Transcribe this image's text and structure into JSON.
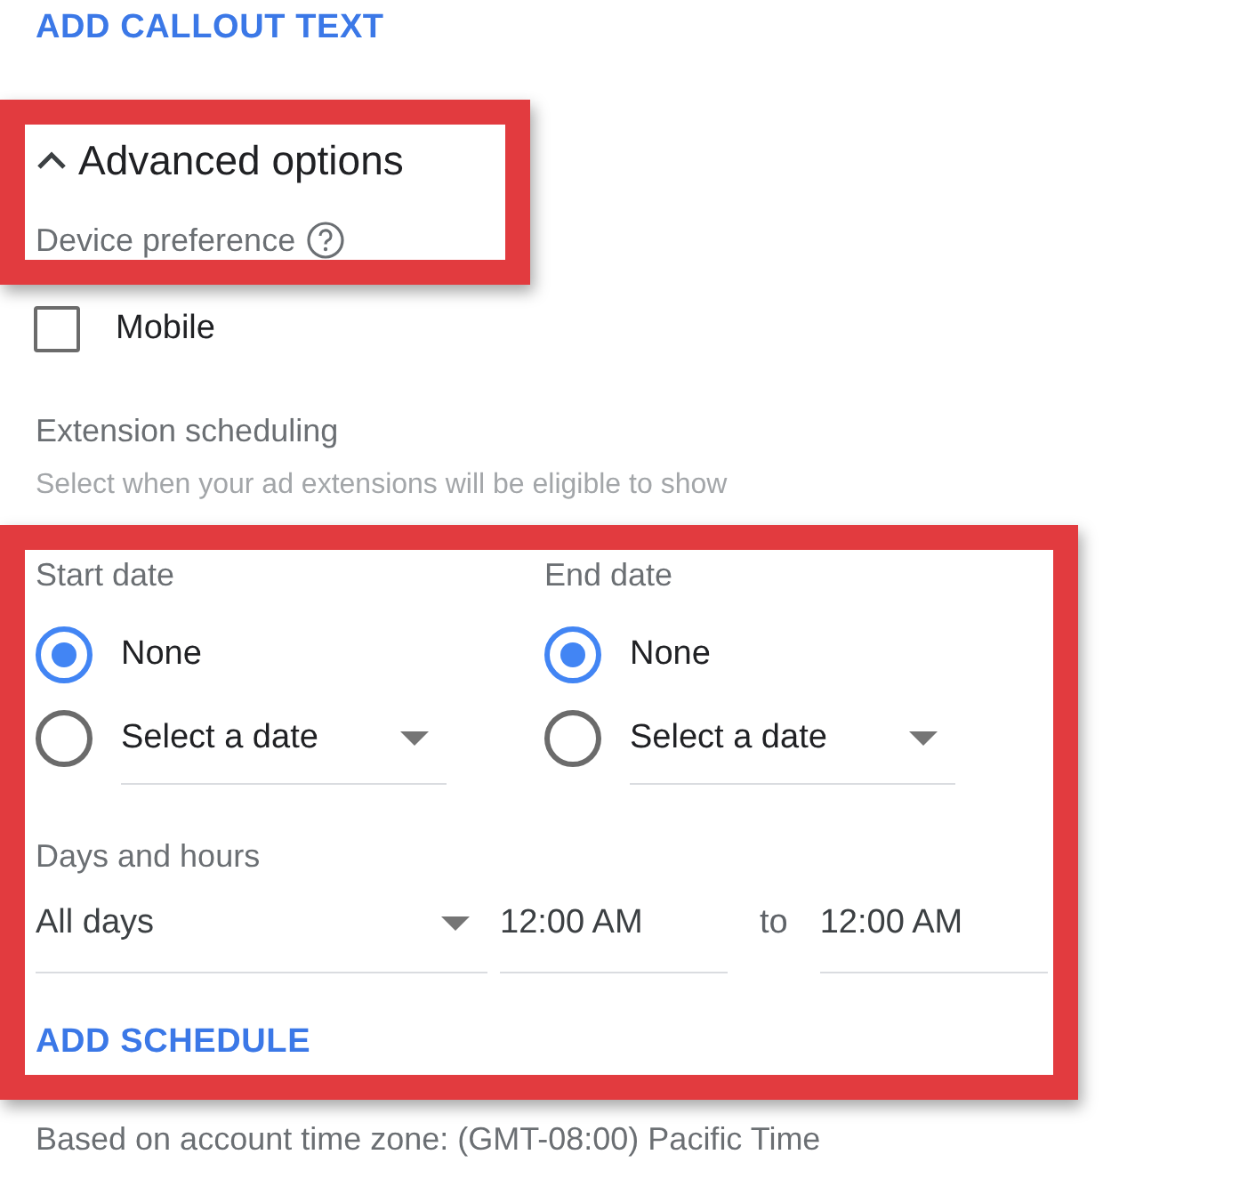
{
  "add_callout_link": "ADD CALLOUT TEXT",
  "advanced_options": {
    "title": "Advanced options",
    "expanded": true
  },
  "device_preference": {
    "label": "Device preference",
    "options": [
      {
        "label": "Mobile",
        "checked": false
      }
    ]
  },
  "extension_scheduling": {
    "title": "Extension scheduling",
    "subtitle": "Select when your ad extensions will be eligible to show"
  },
  "date_groups": [
    {
      "label": "Start date",
      "options": [
        {
          "kind": "text",
          "label": "None",
          "selected": true
        },
        {
          "kind": "dropdown",
          "label": "Select a date",
          "selected": false
        }
      ]
    },
    {
      "label": "End date",
      "options": [
        {
          "kind": "text",
          "label": "None",
          "selected": true
        },
        {
          "kind": "dropdown",
          "label": "Select a date",
          "selected": false
        }
      ]
    }
  ],
  "days_and_hours": {
    "label": "Days and hours",
    "days": "All days",
    "start_time": "12:00 AM",
    "separator": "to",
    "end_time": "12:00 AM"
  },
  "add_schedule_link": "ADD SCHEDULE",
  "time_zone_note": "Based on account time zone: (GMT-08:00) Pacific Time"
}
